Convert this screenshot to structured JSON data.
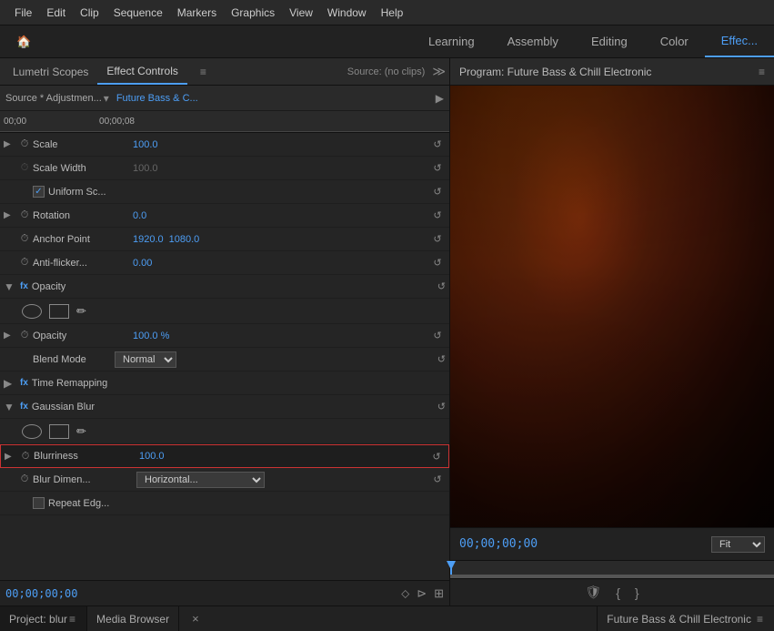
{
  "app": {
    "menu_items": [
      "File",
      "Edit",
      "Clip",
      "Sequence",
      "Markers",
      "Graphics",
      "View",
      "Window",
      "Help"
    ]
  },
  "workspace_tabs": {
    "home_icon": "🏠",
    "tabs": [
      {
        "label": "Learning",
        "active": false
      },
      {
        "label": "Assembly",
        "active": false
      },
      {
        "label": "Editing",
        "active": false
      },
      {
        "label": "Color",
        "active": false
      },
      {
        "label": "Effec...",
        "active": true
      }
    ]
  },
  "left_panel": {
    "tabs": [
      {
        "label": "Lumetri Scopes",
        "active": false
      },
      {
        "label": "Effect Controls",
        "active": true
      },
      {
        "label": "≡",
        "active": false
      }
    ],
    "source_label": "Source: (no clips)",
    "expand_icon": "≫"
  },
  "source_row": {
    "source": "Source * Adjustmen...",
    "dropdown_icon": "▾",
    "clip": "Future Bass & C...",
    "play_icon": "▶"
  },
  "timeline_mini": {
    "time_start": "00;00",
    "time_end": "00;00;08"
  },
  "properties": {
    "scale": {
      "label": "Scale",
      "value": "100.0"
    },
    "scale_width": {
      "label": "Scale Width",
      "value": "100.0"
    },
    "uniform_scale": {
      "label": "Uniform Sc...",
      "checked": true
    },
    "rotation": {
      "label": "Rotation",
      "value": "0.0"
    },
    "anchor_point": {
      "label": "Anchor Point",
      "value1": "1920.0",
      "value2": "1080.0"
    },
    "anti_flicker": {
      "label": "Anti-flicker...",
      "value": "0.00"
    },
    "opacity_section": {
      "label": "Opacity"
    },
    "opacity": {
      "label": "Opacity",
      "value": "100.0 %"
    },
    "blend_mode": {
      "label": "Blend Mode",
      "value": "Normal"
    },
    "time_remapping": {
      "label": "Time Remapping"
    },
    "gaussian_blur": {
      "label": "Gaussian Blur"
    },
    "blurriness": {
      "label": "Blurriness",
      "value": "100.0"
    },
    "blur_dimen": {
      "label": "Blur Dimen...",
      "value": "Horizontal..."
    },
    "repeat_edge": {
      "label": "Repeat Edg...",
      "checked": false
    }
  },
  "bottom_timeline": {
    "time": "00;00;00;00",
    "filter_icon": "⬦",
    "step_icon": "⊳",
    "expand_icon": "⊞"
  },
  "right_panel": {
    "title": "Program: Future Bass & Chill Electronic",
    "menu_icon": "≡"
  },
  "program_controls": {
    "time": "00;00;00;00",
    "fit_label": "Fit"
  },
  "bottom_bar": {
    "project_label": "Project: blur",
    "project_menu": "≡",
    "media_browser": "Media Browser",
    "close_icon": "×",
    "right_title": "Future Bass & Chill Electronic",
    "right_menu": "≡"
  }
}
